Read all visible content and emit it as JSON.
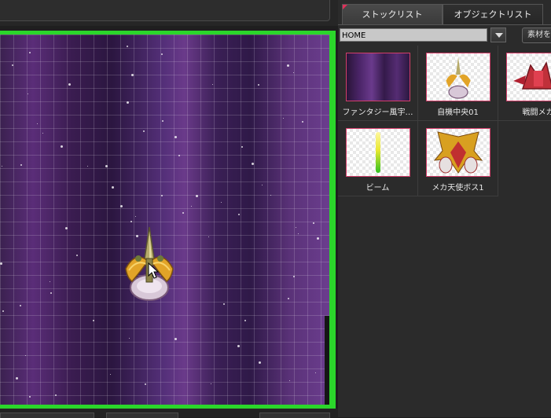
{
  "panel": {
    "tabs": [
      {
        "label": "ストックリスト",
        "active": true
      },
      {
        "label": "オブジェクトリスト",
        "active": false
      }
    ],
    "folder_value": "HOME",
    "material_button_label": "素材を追",
    "items": [
      {
        "label": "ファンタジー風宇…",
        "icon": "space-background-thumbnail"
      },
      {
        "label": "自機中央01",
        "icon": "player-ship-thumbnail"
      },
      {
        "label": "戦闘メカ",
        "icon": "battle-mech-thumbnail"
      },
      {
        "label": "ビーム",
        "icon": "beam-thumbnail"
      },
      {
        "label": "メカ天使ボス1",
        "icon": "mecha-angel-boss-thumbnail"
      }
    ]
  },
  "colors": {
    "canvas_border": "#2bd62b",
    "thumb_border": "#d33e6a",
    "tab_accent": "#e0305a"
  }
}
